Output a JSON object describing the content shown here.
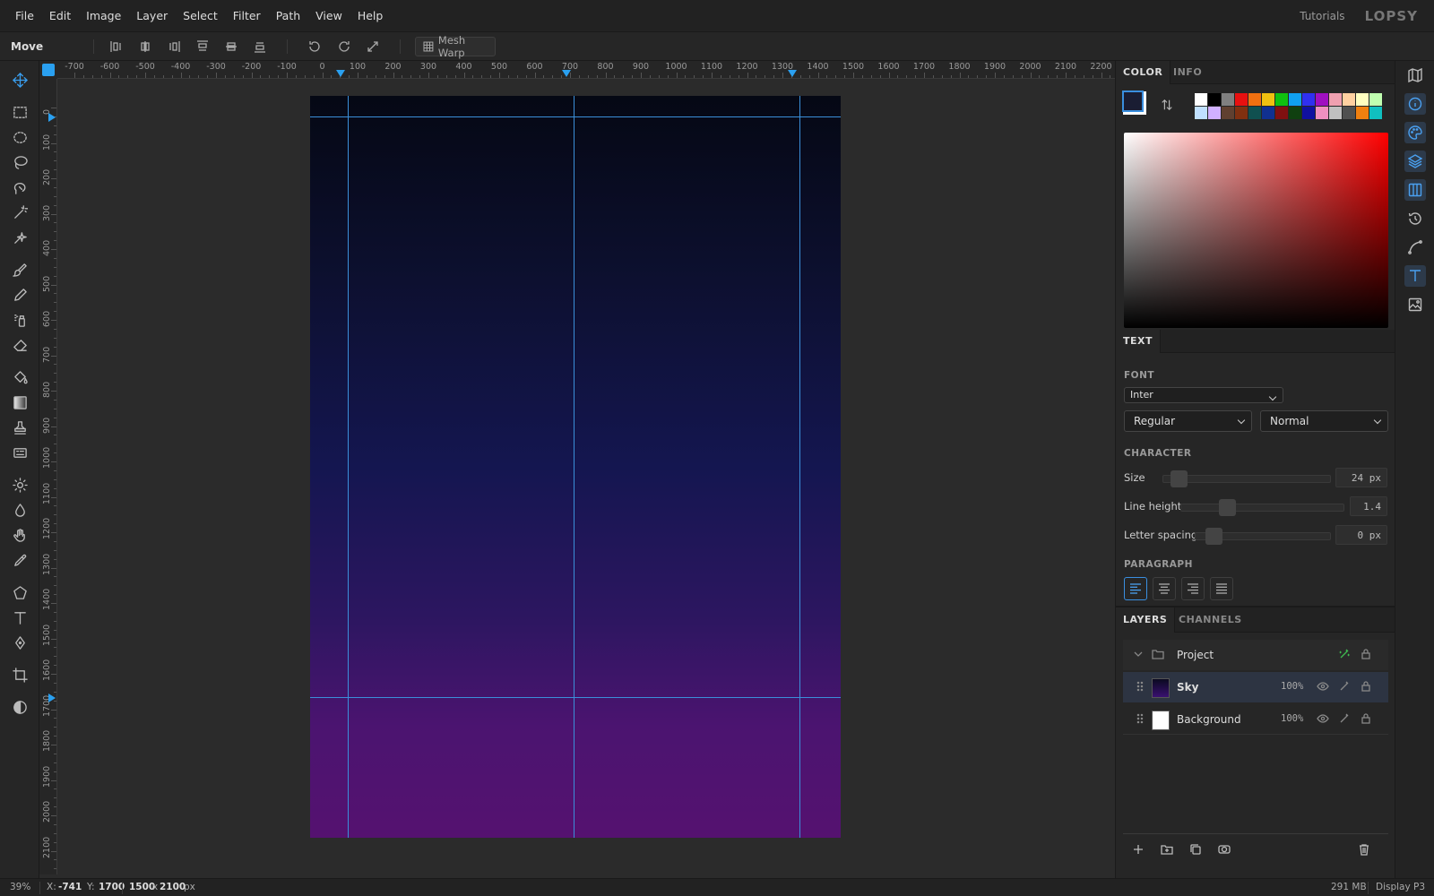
{
  "menu": [
    "File",
    "Edit",
    "Image",
    "Layer",
    "Select",
    "Filter",
    "Path",
    "View",
    "Help"
  ],
  "header": {
    "tutorials": "Tutorials",
    "logo": "LOPSY"
  },
  "options": {
    "tool_name": "Move",
    "mesh_warp": "Mesh Warp"
  },
  "ruler": {
    "h_labels": [
      "-700",
      "-600",
      "-500",
      "-400",
      "-300",
      "-200",
      "-100",
      "0",
      "100",
      "200",
      "300",
      "400",
      "500",
      "600",
      "700",
      "800",
      "900",
      "1000",
      "1100",
      "1200",
      "1300",
      "1400",
      "1500",
      "1600",
      "1700",
      "1800",
      "1900",
      "2000",
      "2100",
      "2200"
    ],
    "v_labels": [
      "0",
      "100",
      "200",
      "300",
      "400",
      "500",
      "600",
      "700",
      "800",
      "900",
      "1000",
      "1100",
      "1200",
      "1300",
      "1400",
      "1500",
      "1600",
      "1700",
      "1800",
      "1900",
      "2000",
      "2100"
    ]
  },
  "canvas": {
    "gradient": [
      "#050814",
      "#141650",
      "#551270"
    ],
    "guide_color": "#3b8fd9"
  },
  "status": {
    "zoom": "39%",
    "coords_x_label": "X:",
    "coords_x": "-741",
    "coords_y_label": "Y:",
    "coords_y": "1700",
    "doc_w": "1500",
    "doc_x": "x",
    "doc_h": "2100",
    "doc_unit": "px",
    "memory": "291 MB",
    "profile": "Display P3"
  },
  "panels": {
    "color_tab": "COLOR",
    "info_tab": "INFO",
    "swatches": [
      "#ffffff",
      "#000000",
      "#808080",
      "#e81010",
      "#f07010",
      "#f0c010",
      "#10c010",
      "#10a0f0",
      "#3030f0",
      "#a010c0",
      "#f0a0b0",
      "#ffd0a0",
      "#ffffc0",
      "#c0ffb0",
      "#c0e0ff",
      "#d0b0ff",
      "#604030",
      "#803010",
      "#105050",
      "#103090",
      "#801010",
      "#104010",
      "#1010a0",
      "#f090c0",
      "#c0c0c0",
      "#505050",
      "#f08010",
      "#10c0c0"
    ],
    "text_tab": "TEXT",
    "font_label": "FONT",
    "font_family": "Inter",
    "font_weight": "Regular",
    "font_style": "Normal",
    "character_label": "CHARACTER",
    "size_label": "Size",
    "size_value": "24 px",
    "line_height_label": "Line height",
    "line_height_value": "1.4",
    "letter_spacing_label": "Letter spacing",
    "letter_spacing_value": "0 px",
    "paragraph_label": "PARAGRAPH",
    "layers_tab": "LAYERS",
    "channels_tab": "CHANNELS",
    "layers": [
      {
        "name": "Project",
        "type": "group"
      },
      {
        "name": "Sky",
        "opacity": "100%"
      },
      {
        "name": "Background",
        "opacity": "100%"
      }
    ]
  }
}
